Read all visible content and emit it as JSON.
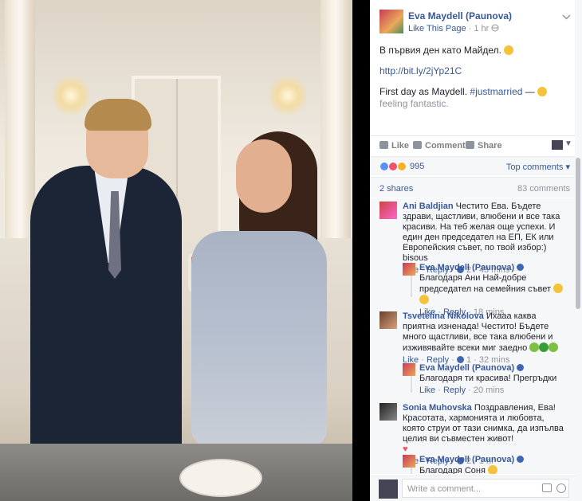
{
  "post": {
    "author": "Eva Maydell (Paunova)",
    "like_page": "Like This Page",
    "sep": " · ",
    "time": "1 hr",
    "text_bg": "В първия ден като Майдел.",
    "link": "http://bit.ly/2jYp21C",
    "text_en_start": "First day as Maydell.",
    "hashtag": "#justmarried",
    "feeling_dash": "—",
    "feeling": "feeling fantastic."
  },
  "actions": {
    "like": "Like",
    "comment": "Comment",
    "share": "Share"
  },
  "reactions": {
    "count": "995",
    "top_comments": "Top comments"
  },
  "stats": {
    "shares": "2 shares",
    "comments": "83 comments"
  },
  "comments": [
    {
      "name": "Ani Baldjian",
      "text": "Честито Ева. Бъдете здрави, щастливи, влюбени и все така красиви. На теб желая още успехи. И един ден председател на ЕП, ЕК или Европейския съвет, по твой избор:) bisous",
      "like": "Like",
      "reply": "Reply",
      "likes": "2",
      "time": "43 mins",
      "reply_item": {
        "name": "Eva Maydell (Paunova)",
        "text": "Благодаря Ани Най-добре председател на семейния съвет",
        "like": "Like",
        "reply": "Reply",
        "time": "18 mins"
      }
    },
    {
      "name": "Tsvetelina Nikolova",
      "text": "Ихааа каква приятна изненада! Честито! Бъдете много щастливи, все така влюбени и изживявайте всеки миг заедно",
      "like": "Like",
      "reply": "Reply",
      "likes": "1",
      "time": "32 mins",
      "reply_item": {
        "name": "Eva Maydell (Paunova)",
        "text": "Благодаря ти красива! Прегръдки",
        "like": "Like",
        "reply": "Reply",
        "time": "20 mins"
      }
    },
    {
      "name": "Sonia Muhovska",
      "text": "Поздравления, Ева! Красотата, хармонията и любовта, която струи от тази снимка, да изпълва целия ви съвместен живот!",
      "like": "Like",
      "reply": "Reply",
      "likes": "2",
      "time": "1 hr",
      "reply_item": {
        "name": "Eva Maydell (Paunova)",
        "text": "Благодаря Соня",
        "like": "",
        "reply": "",
        "time": ""
      }
    }
  ],
  "composer": {
    "placeholder": "Write a comment..."
  },
  "colors": {
    "link": "#365899",
    "accent": "#4267b2",
    "muted": "#90949c",
    "panel_bg": "#f6f7f9"
  }
}
